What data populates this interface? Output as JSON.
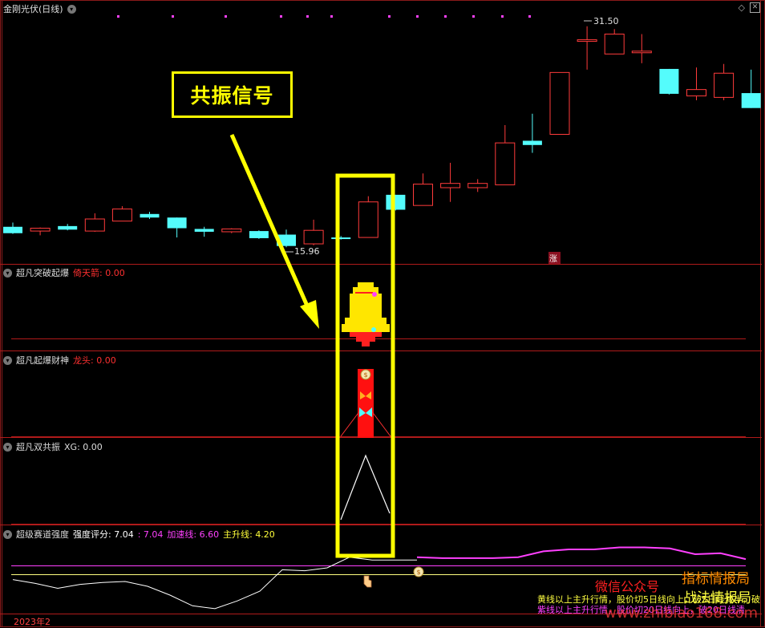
{
  "header": {
    "stock_title": "金刚光伏(日线)",
    "high_label": "31.50",
    "low_label": "15.96",
    "zhang_badge": "涨"
  },
  "banner": {
    "text": "共振信号"
  },
  "panels": [
    {
      "name": "超凡突破起爆",
      "field": "倚天箭",
      "value": "0.00"
    },
    {
      "name": "超凡起爆财神",
      "field": "龙头",
      "value": "0.00"
    },
    {
      "name": "超凡双共振",
      "field": "XG",
      "value": "0.00"
    }
  ],
  "strength_panel": {
    "name": "超级赛道强度",
    "score_label": "强度评分",
    "score_value": "7.04",
    "score_value2": "7.04",
    "accel_label": "加速线",
    "accel_value": "6.60",
    "main_label": "主升线",
    "main_value": "4.20"
  },
  "watermarks": {
    "wechat": "微信公众号",
    "brand1": "指标情报局",
    "brand2": "战法情报局",
    "url": "www.zhibiao168.com"
  },
  "notes": {
    "line1": "黄线以上主升行情，股价切5日线向上，破5日线减半，破",
    "line2": "紫线以上主升行情，股价切20日线向上，破20日线清"
  },
  "footer": {
    "date": "2023年2"
  },
  "colors": {
    "up": "#ff3b3b",
    "down": "#54fcfc",
    "yellow": "#ffff00",
    "magenta": "#ff40ff",
    "separator": "#b01a1a"
  },
  "icons": [
    "chevron-down-icon",
    "diamond-icon",
    "close-icon",
    "bell-icon",
    "money-bag-icon",
    "butterfly-icon"
  ],
  "chart_data": {
    "type": "candlestick",
    "candles": [
      {
        "o": 17.4,
        "h": 17.7,
        "l": 16.9,
        "c": 16.95
      },
      {
        "o": 17.1,
        "h": 17.35,
        "l": 16.8,
        "c": 17.3
      },
      {
        "o": 17.45,
        "h": 17.6,
        "l": 17.15,
        "c": 17.2
      },
      {
        "o": 17.1,
        "h": 18.35,
        "l": 17.05,
        "c": 17.95
      },
      {
        "o": 17.8,
        "h": 18.85,
        "l": 17.8,
        "c": 18.65
      },
      {
        "o": 18.3,
        "h": 18.45,
        "l": 17.95,
        "c": 18.05
      },
      {
        "o": 18.05,
        "h": 18.05,
        "l": 16.65,
        "c": 17.3
      },
      {
        "o": 17.25,
        "h": 17.4,
        "l": 16.7,
        "c": 17.05
      },
      {
        "o": 17.05,
        "h": 17.3,
        "l": 16.95,
        "c": 17.25
      },
      {
        "o": 17.1,
        "h": 17.15,
        "l": 16.55,
        "c": 16.6
      },
      {
        "o": 16.85,
        "h": 17.2,
        "l": 15.96,
        "c": 16.05
      },
      {
        "o": 16.2,
        "h": 17.9,
        "l": 16.1,
        "c": 17.15
      },
      {
        "o": 16.65,
        "h": 16.75,
        "l": 16.5,
        "c": 16.55
      },
      {
        "o": 16.65,
        "h": 19.55,
        "l": 16.65,
        "c": 19.15
      },
      {
        "o": 19.65,
        "h": 19.65,
        "l": 18.55,
        "c": 18.6
      },
      {
        "o": 18.9,
        "h": 21.15,
        "l": 18.9,
        "c": 20.4
      },
      {
        "o": 20.15,
        "h": 21.9,
        "l": 19.15,
        "c": 20.45
      },
      {
        "o": 20.15,
        "h": 20.75,
        "l": 19.85,
        "c": 20.45
      },
      {
        "o": 20.35,
        "h": 24.55,
        "l": 20.35,
        "c": 23.3
      },
      {
        "o": 23.45,
        "h": 25.35,
        "l": 22.6,
        "c": 23.15
      },
      {
        "o": 23.9,
        "h": 28.25,
        "l": 23.9,
        "c": 28.25
      },
      {
        "o": 30.55,
        "h": 31.5,
        "l": 28.45,
        "c": 30.55
      },
      {
        "o": 29.55,
        "h": 31.3,
        "l": 29.55,
        "c": 30.95
      },
      {
        "o": 29.75,
        "h": 30.95,
        "l": 28.9,
        "c": 29.75
      },
      {
        "o": 28.5,
        "h": 28.5,
        "l": 26.7,
        "c": 26.75
      },
      {
        "o": 26.6,
        "h": 28.6,
        "l": 26.3,
        "c": 27.05
      },
      {
        "o": 26.5,
        "h": 28.85,
        "l": 26.3,
        "c": 28.2
      },
      {
        "o": 26.8,
        "h": 28.45,
        "l": 25.75,
        "c": 25.75
      }
    ],
    "ylim": [
      15.3,
      32.5
    ],
    "strength_series": {
      "white": [
        5.0,
        4.6,
        4.1,
        4.5,
        4.7,
        4.8,
        4.3,
        3.4,
        2.3,
        2.0,
        2.8,
        3.8,
        6.0,
        5.9,
        6.2,
        7.3,
        7.0,
        7.0,
        7.0
      ],
      "magenta": [
        7.3,
        7.2,
        7.2,
        7.2,
        7.3,
        7.9,
        8.1,
        8.1,
        8.3,
        8.3,
        8.2,
        7.6,
        7.7,
        7.1
      ],
      "accel_line": 6.6,
      "main_line": 4.2
    }
  }
}
